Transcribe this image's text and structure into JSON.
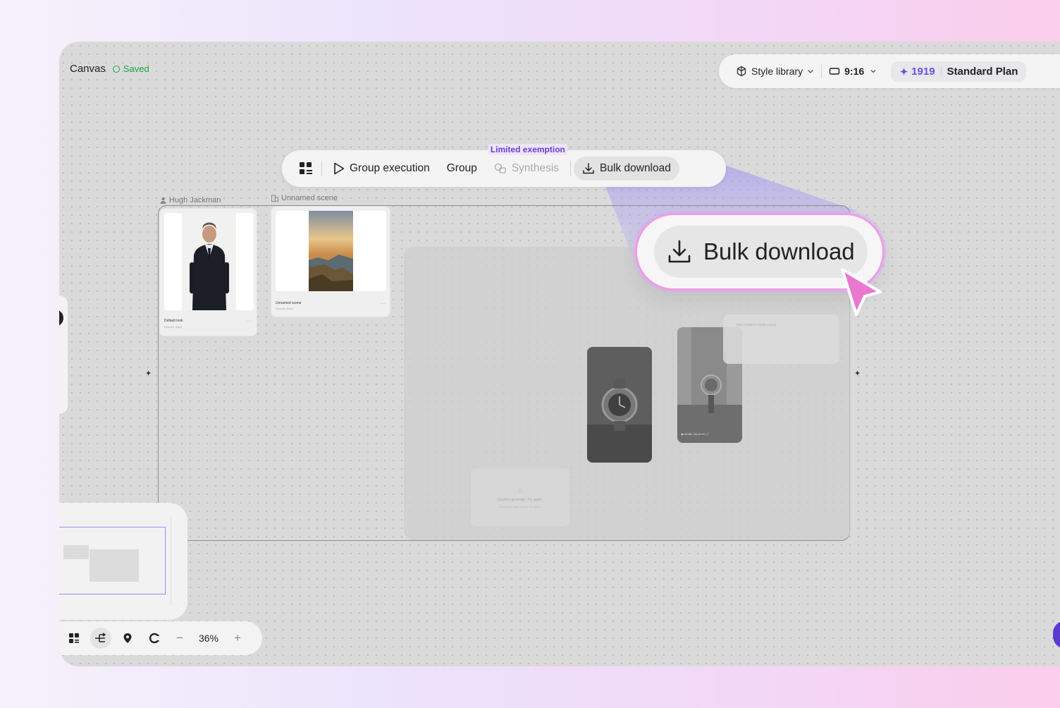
{
  "header": {
    "title": "Canvas",
    "status": "Saved"
  },
  "topbar": {
    "style_library": "Style library",
    "aspect_ratio": "9:16",
    "credits": "1919",
    "plan": "Standard Plan"
  },
  "toolbar": {
    "group_execution": "Group execution",
    "group": "Group",
    "limited_exemption": "Limited exemption",
    "synthesis": "Synthesis",
    "bulk_download": "Bulk download"
  },
  "cards": {
    "character_label": "Hugh Jackman",
    "character_title": "Default look",
    "character_sub": "Episode (bad)",
    "scene_label": "Unnamed scene",
    "scene_title": "Unnamed scene",
    "scene_sub": "Episode (bad)",
    "more": "···"
  },
  "error_card": {
    "title": "Couldn't generate. Try again.",
    "subtitle": "Something went wrong. Try again."
  },
  "text_card": {
    "text": "Time Crafted in Quiet Luxury"
  },
  "video": {
    "controls": "▶ 00:05 / 00:10 ━━ 🔊"
  },
  "zoom": {
    "value": "36%",
    "minus": "−",
    "plus": "+"
  },
  "callout": {
    "label": "Bulk download"
  },
  "colors": {
    "accent": "#6b4fe0",
    "saved_green": "#1da34a",
    "highlight_pink": "#ef9ce6",
    "canvas_bg": "#dadada"
  }
}
